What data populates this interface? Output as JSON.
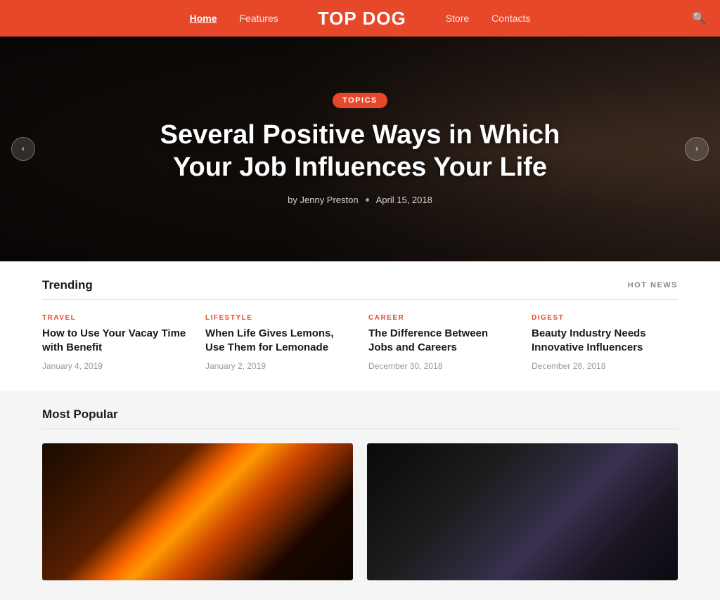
{
  "header": {
    "logo": "TOP DOG",
    "nav": [
      {
        "label": "Home",
        "active": true
      },
      {
        "label": "Features",
        "active": false
      },
      {
        "label": "Store",
        "active": false
      },
      {
        "label": "Contacts",
        "active": false
      }
    ],
    "search_icon": "🔍"
  },
  "hero": {
    "tag": "topics",
    "title": "Several Positive Ways in Which Your Job Influences Your Life",
    "author": "by Jenny Preston",
    "date": "April 15, 2018",
    "prev_icon": "‹",
    "next_icon": "›"
  },
  "trending": {
    "section_title": "Trending",
    "hot_news_label": "HOT NEWS",
    "items": [
      {
        "category": "TRAVEL",
        "title": "How to Use Your Vacay Time with Benefit",
        "date": "January 4, 2019"
      },
      {
        "category": "LIFESTYLE",
        "title": "When Life Gives Lemons, Use Them for Lemonade",
        "date": "January 2, 2019"
      },
      {
        "category": "CAREER",
        "title": "The Difference Between Jobs and Careers",
        "date": "December 30, 2018"
      },
      {
        "category": "DIGEST",
        "title": "Beauty Industry Needs Innovative Influencers",
        "date": "December 28, 2018"
      }
    ]
  },
  "popular": {
    "section_title": "Most Popular"
  }
}
